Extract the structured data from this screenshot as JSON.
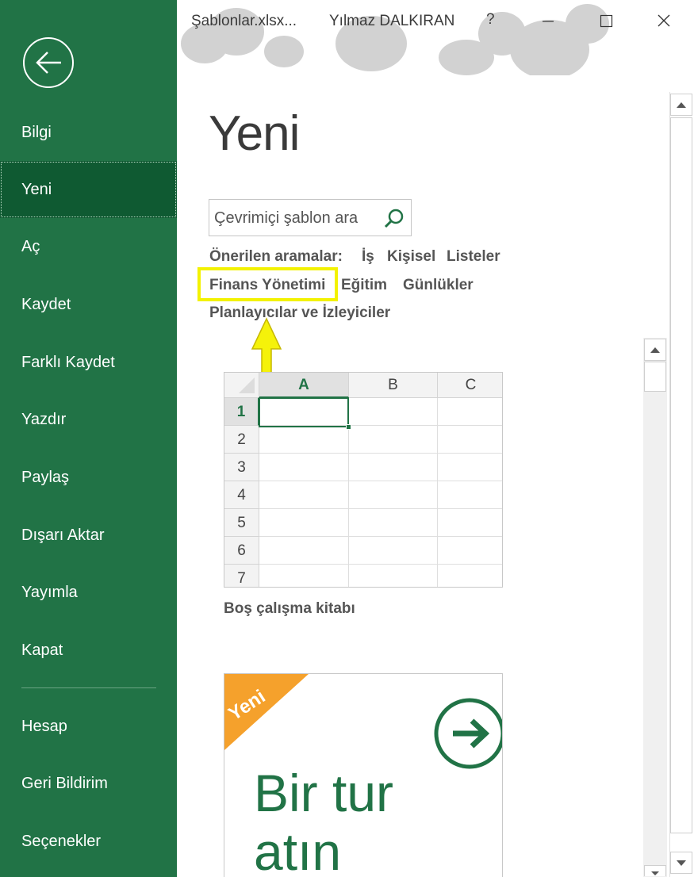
{
  "window": {
    "file_name": "Şablonlar.xlsx...",
    "user_name": "Yılmaz DALKIRAN",
    "help_label": "?"
  },
  "sidebar": {
    "items": [
      {
        "label": "Bilgi"
      },
      {
        "label": "Yeni"
      },
      {
        "label": "Aç"
      },
      {
        "label": "Kaydet"
      },
      {
        "label": "Farklı Kaydet"
      },
      {
        "label": "Yazdır"
      },
      {
        "label": "Paylaş"
      },
      {
        "label": "Dışarı Aktar"
      },
      {
        "label": "Yayımla"
      },
      {
        "label": "Kapat"
      }
    ],
    "bottom_items": [
      {
        "label": "Hesap"
      },
      {
        "label": "Geri Bildirim"
      },
      {
        "label": "Seçenekler"
      }
    ],
    "active": "Yeni"
  },
  "main": {
    "title": "Yeni",
    "search": {
      "placeholder": "Çevrimiçi şablon ara",
      "value": ""
    },
    "suggested_label": "Önerilen aramalar:",
    "suggested": [
      "İş",
      "Kişisel",
      "Listeler",
      "Finans Yönetimi",
      "Eğitim",
      "Günlükler",
      "Planlayıcılar ve İzleyiciler"
    ],
    "blank_workbook": {
      "label": "Boş çalışma kitabı",
      "columns": [
        "A",
        "B",
        "C"
      ],
      "rows": [
        "1",
        "2",
        "3",
        "4",
        "5",
        "6",
        "7"
      ]
    },
    "tour": {
      "badge": "Yeni",
      "line1": "Bir tur",
      "line2": "atın"
    }
  },
  "colors": {
    "sidebar": "#217346",
    "sidebar_active": "#0f5a32",
    "highlight": "#f3f200",
    "badge": "#f5a12c"
  }
}
